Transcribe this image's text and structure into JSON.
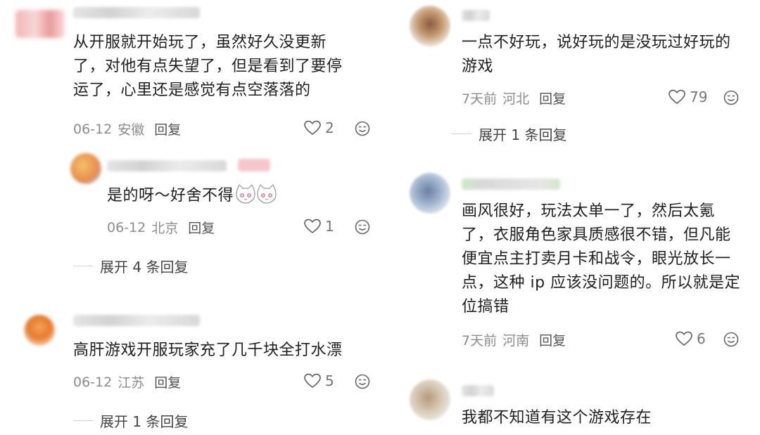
{
  "comments_left": [
    {
      "text": "从开服就开始玩了，虽然好久没更新\n了，对他有点失望了，但是看到了要停\n运了，心里还是感觉有点空落落的",
      "date": "06-12",
      "location": "安徽",
      "reply_label": "回复",
      "likes": "2"
    },
    {
      "text": "是的呀～好舍不得",
      "date": "06-12",
      "location": "北京",
      "reply_label": "回复",
      "likes": "1",
      "expand": "展开 4 条回复"
    },
    {
      "text": "高肝游戏开服玩家充了几千块全打水漂",
      "date": "06-12",
      "location": "江苏",
      "reply_label": "回复",
      "likes": "5",
      "expand": "展开 1 条回复"
    }
  ],
  "comments_right": [
    {
      "text": "一点不好玩，说好玩的是没玩过好玩的\n游戏",
      "date": "7天前",
      "location": "河北",
      "reply_label": "回复",
      "likes": "79",
      "expand": "展开 1 条回复"
    },
    {
      "text": "画风很好，玩法太单一了，然后太氪\n了，衣服角色家具质感很不错，但凡能\n便宜点主打卖月卡和战令，眼光放长一\n点，这种 ip 应该没问题的。所以就是定\n位搞错",
      "date": "7天前",
      "location": "河南",
      "reply_label": "回复",
      "likes": "6"
    },
    {
      "text": "我都不知道有这个游戏存在"
    }
  ],
  "colors": {
    "text": "#1f1f1f",
    "meta": "#8c8c8c",
    "icon": "#666666"
  }
}
